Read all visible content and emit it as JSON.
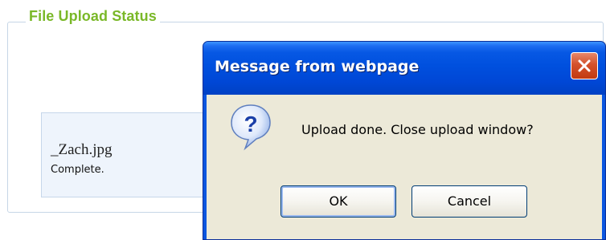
{
  "panel": {
    "legend": "File Upload Status"
  },
  "file": {
    "name": "_Zach.jpg",
    "status": "Complete."
  },
  "dialog": {
    "title": "Message from webpage",
    "message": "Upload done. Close upload window?",
    "ok_label": "OK",
    "cancel_label": "Cancel",
    "icon": "question-icon",
    "close_icon": "close-icon"
  },
  "colors": {
    "legend_green": "#7ab828",
    "titlebar_blue": "#0050de",
    "dialog_body": "#ece9d8",
    "close_red": "#d3512b",
    "card_bg": "#eef4fc"
  }
}
